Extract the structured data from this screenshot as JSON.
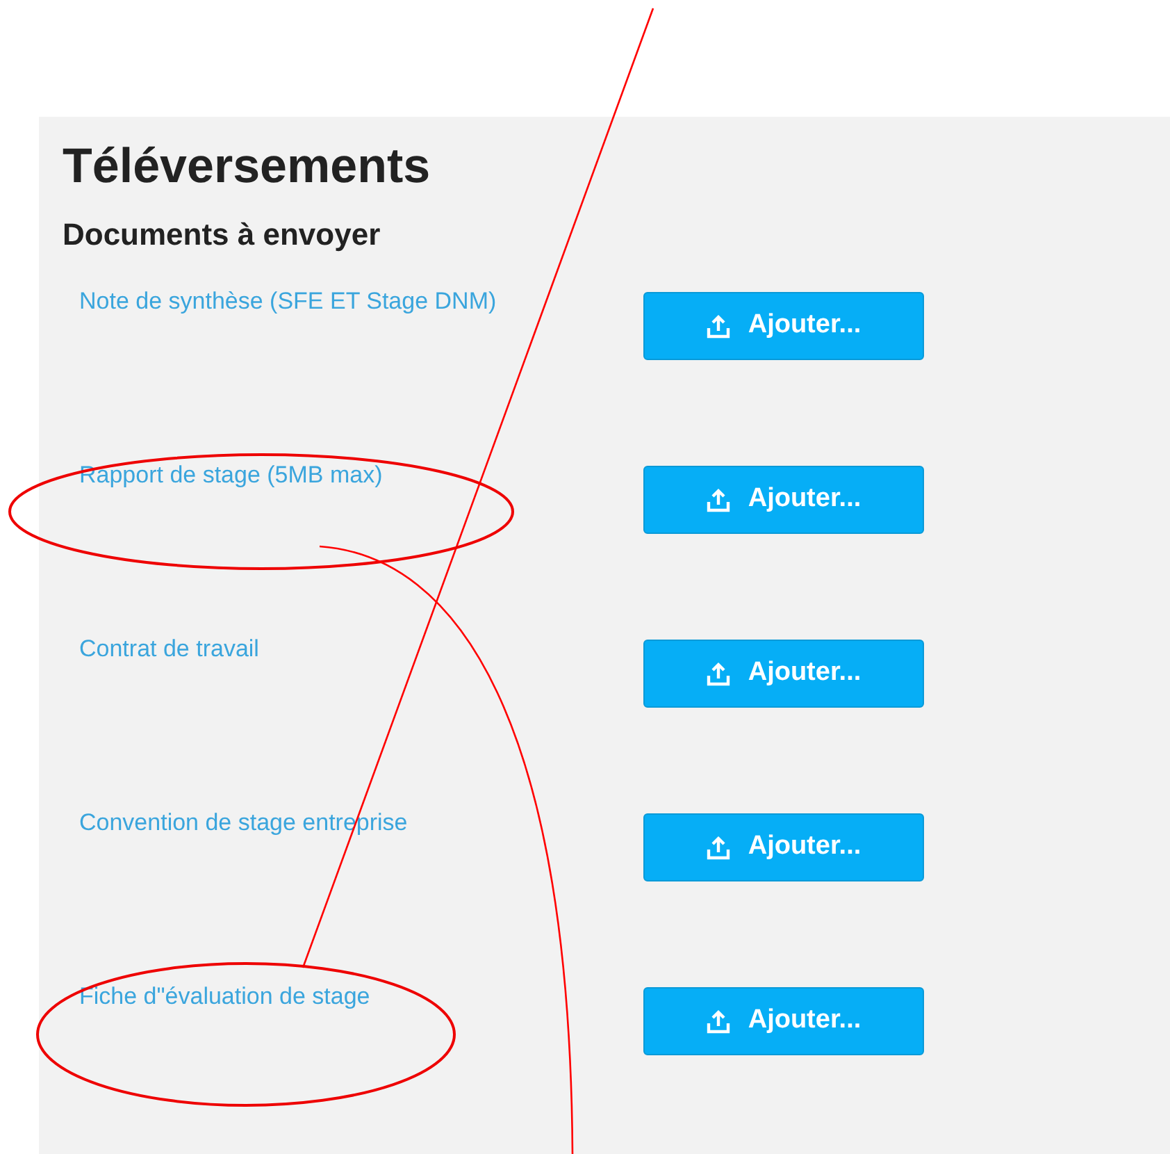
{
  "panel": {
    "title": "Téléversements",
    "subtitle": "Documents à envoyer"
  },
  "documents": [
    {
      "label": "Note de synthèse (SFE ET Stage DNM)",
      "button": "Ajouter..."
    },
    {
      "label": "Rapport de stage (5MB max)",
      "button": "Ajouter..."
    },
    {
      "label": "Contrat de travail",
      "button": "Ajouter..."
    },
    {
      "label": "Convention de stage entreprise",
      "button": "Ajouter..."
    },
    {
      "label": "Fiche d\"évaluation de stage",
      "button": "Ajouter..."
    }
  ]
}
